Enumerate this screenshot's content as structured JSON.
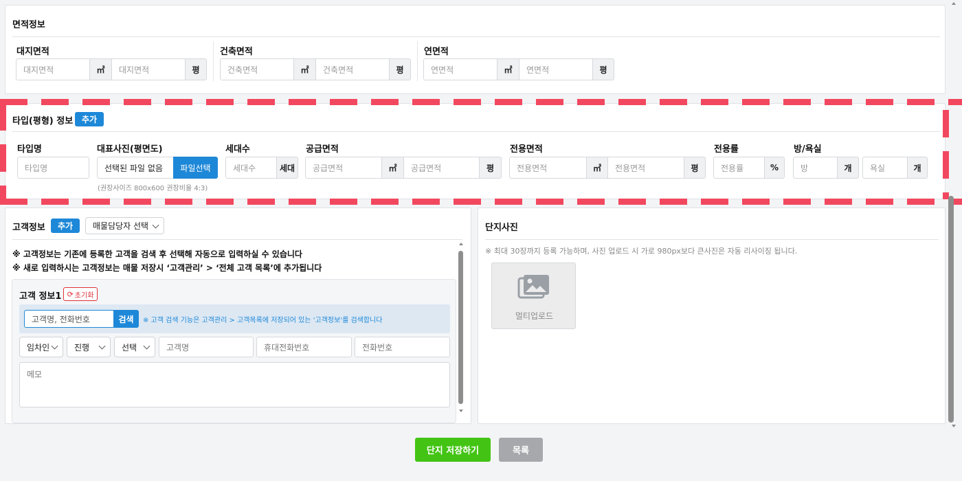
{
  "area_section": {
    "title": "면적정보",
    "groups": [
      {
        "label": "대지면적",
        "ph1": "대지면적",
        "unit1": "㎡",
        "ph2": "대지면적",
        "unit2": "평"
      },
      {
        "label": "건축면적",
        "ph1": "건축면적",
        "unit1": "㎡",
        "ph2": "건축면적",
        "unit2": "평"
      },
      {
        "label": "연면적",
        "ph1": "연면적",
        "unit1": "㎡",
        "ph2": "연면적",
        "unit2": "평"
      }
    ]
  },
  "type_section": {
    "title": "타입(평형) 정보",
    "add_label": "추가",
    "type_name": {
      "label": "타입명",
      "placeholder": "타입명"
    },
    "photo": {
      "label": "대표사진(평면도)",
      "file_text": "선택된 파일 없음",
      "button": "파일선택",
      "hint": "(권장사이즈 800x600 권장비율 4:3)"
    },
    "households": {
      "label": "세대수",
      "placeholder": "세대수",
      "unit": "세대"
    },
    "supply_area": {
      "label": "공급면적",
      "ph1": "공급면적",
      "unit1": "㎡",
      "ph2": "공급면적",
      "unit2": "평"
    },
    "exclusive_area": {
      "label": "전용면적",
      "ph1": "전용면적",
      "unit1": "㎡",
      "ph2": "전용면적",
      "unit2": "평"
    },
    "exclusive_rate": {
      "label": "전용률",
      "placeholder": "전용률",
      "unit": "%"
    },
    "rooms": {
      "label": "방/욕실",
      "ph1": "방",
      "unit1": "개",
      "ph2": "욕실",
      "unit2": "개"
    }
  },
  "customer_section": {
    "title": "고객정보",
    "add_label": "추가",
    "manager_select": "매물담당자 선택",
    "notice1": "※ 고객정보는 기존에 등록한 고객을 검색 후 선택해 자동으로 입력하실 수 있습니다",
    "notice2": "※ 새로 입력하시는 고객정보는 매물 저장시 ‘고객관리’ > ‘전체 고객 목록’에 추가됩니다",
    "card": {
      "title": "고객 정보1",
      "reset_label": "초기화",
      "search_placeholder": "고객명, 전화번호",
      "search_button": "검색",
      "search_hint": "※ 고객 검색 기능은 고객관리 > 고객목록에 저장되어 있는 '고객정보'를 검색합니다",
      "role_select": "임차인",
      "status_select": "진행",
      "option_select": "선택",
      "name_placeholder": "고객명",
      "mobile_placeholder": "휴대전화번호",
      "phone_placeholder": "전화번호",
      "memo_placeholder": "메모"
    }
  },
  "photo_section": {
    "title": "단지사진",
    "notice": "※ 최대 30장까지 등록 가능하며, 사진 업로드 시 가로 980px보다 큰사진은 자동 리사이징 됩니다.",
    "upload_label": "멀티업로드"
  },
  "footer": {
    "save_label": "단지 저장하기",
    "list_label": "목록"
  },
  "colors": {
    "accent": "#1e88d8",
    "save": "#43c414",
    "highlight_dash": "#f2485f"
  }
}
